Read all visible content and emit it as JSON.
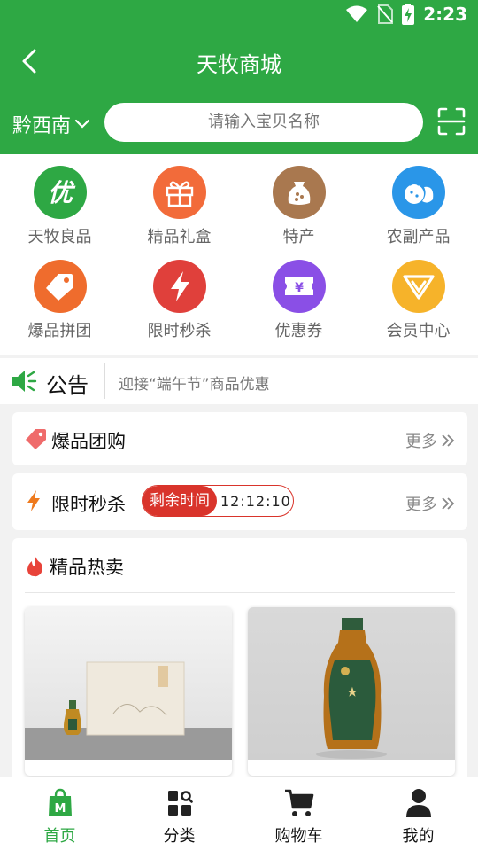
{
  "status": {
    "time": "2:23"
  },
  "header": {
    "title": "天牧商城",
    "city": "黔西南",
    "search_placeholder": "请输入宝贝名称"
  },
  "categories": [
    {
      "label": "天牧良品",
      "icon": "you-badge-icon",
      "color": "#2ea844"
    },
    {
      "label": "精品礼盒",
      "icon": "gift-box-icon",
      "color": "#f26b3a"
    },
    {
      "label": "特产",
      "icon": "grain-sack-icon",
      "color": "#a9784f"
    },
    {
      "label": "农副产品",
      "icon": "vegetables-icon",
      "color": "#2a96e8"
    },
    {
      "label": "爆品拼团",
      "icon": "price-tag-icon",
      "color": "#ef6c2d"
    },
    {
      "label": "限时秒杀",
      "icon": "lightning-icon",
      "color": "#e0403b"
    },
    {
      "label": "优惠券",
      "icon": "coupon-icon",
      "color": "#8a4fe6"
    },
    {
      "label": "会员中心",
      "icon": "vip-icon",
      "color": "#f6b32a"
    }
  ],
  "notice": {
    "label": "公告",
    "text": "迎接“端午节”商品优惠"
  },
  "group_buy": {
    "title": "爆品团购",
    "more": "更多"
  },
  "flash_sale": {
    "title": "限时秒杀",
    "countdown_label": "剩余时间",
    "countdown": "12:12:10",
    "more": "更多"
  },
  "hot": {
    "title": "精品热卖"
  },
  "tabs": [
    {
      "label": "首页",
      "icon": "shopping-bag-icon",
      "active": true
    },
    {
      "label": "分类",
      "icon": "category-grid-icon",
      "active": false
    },
    {
      "label": "购物车",
      "icon": "cart-icon",
      "active": false
    },
    {
      "label": "我的",
      "icon": "user-icon",
      "active": false
    }
  ],
  "colors": {
    "brand": "#2ea844",
    "accent_red": "#d9342b"
  }
}
